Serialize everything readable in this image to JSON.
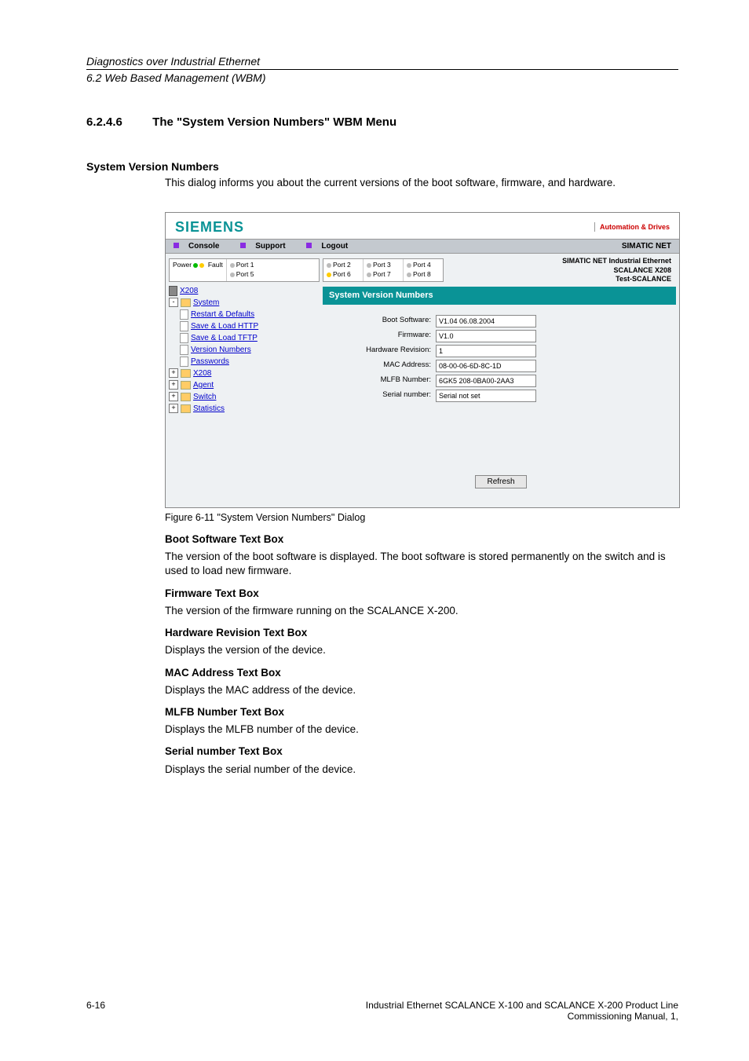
{
  "header": {
    "title": "Diagnostics over Industrial Ethernet",
    "subtitle": "6.2 Web Based Management (WBM)"
  },
  "section": {
    "number": "6.2.4.6",
    "title": "The \"System Version Numbers\" WBM Menu"
  },
  "sysver": {
    "heading": "System Version Numbers",
    "intro": "This dialog informs you about the current versions of the boot software, firmware, and hardware."
  },
  "screenshot": {
    "brand": "SIEMENS",
    "tagline": "Automation & Drives",
    "topbar": {
      "console": "Console",
      "support": "Support",
      "logout": "Logout",
      "right": "SIMATIC NET"
    },
    "ports": {
      "powerfault": "Power",
      "fault": "Fault",
      "p1": "Port 1",
      "p2": "Port 2",
      "p3": "Port 3",
      "p4": "Port 4",
      "p5": "Port 5",
      "p6": "Port 6",
      "p7": "Port 7",
      "p8": "Port 8"
    },
    "rightlabel": {
      "l1": "SIMATIC NET Industrial Ethernet",
      "l2": "SCALANCE X208",
      "l3": "Test-SCALANCE"
    },
    "panel_title": "System Version Numbers",
    "tree": {
      "root": "X208",
      "system": "System",
      "restart": "Restart & Defaults",
      "http": "Save & Load HTTP",
      "tftp": "Save & Load TFTP",
      "ver": "Version Numbers",
      "pwd": "Passwords",
      "x208": "X208",
      "agent": "Agent",
      "switch": "Switch",
      "stats": "Statistics"
    },
    "form": {
      "boot_lbl": "Boot Software:",
      "boot_val": "V1.04 06.08.2004",
      "fw_lbl": "Firmware:",
      "fw_val": "V1.0",
      "hw_lbl": "Hardware Revision:",
      "hw_val": "1",
      "mac_lbl": "MAC Address:",
      "mac_val": "08-00-06-6D-8C-1D",
      "mlfb_lbl": "MLFB Number:",
      "mlfb_val": "6GK5 208-0BA00-2AA3",
      "serial_lbl": "Serial number:",
      "serial_val": "Serial not set",
      "refresh": "Refresh"
    }
  },
  "fig": {
    "caption": "Figure 6-11    \"System Version Numbers\" Dialog"
  },
  "desc": {
    "boot_h": "Boot Software Text Box",
    "boot_p": "The version of the boot software is displayed. The boot software is stored permanently on the switch and is used to load new firmware.",
    "fw_h": "Firmware Text Box",
    "fw_p": "The version of the firmware running on the SCALANCE X-200.",
    "hw_h": "Hardware Revision Text Box",
    "hw_p": "Displays the version of the device.",
    "mac_h": "MAC Address Text Box",
    "mac_p": "Displays the MAC address of the device.",
    "mlfb_h": "MLFB Number Text Box",
    "mlfb_p": "Displays the MLFB number of the device.",
    "serial_h": "Serial number Text Box",
    "serial_p": "Displays the serial number of the device."
  },
  "footer": {
    "page": "6-16",
    "line1": "Industrial Ethernet SCALANCE X-100 and SCALANCE X-200 Product Line",
    "line2": "Commissioning Manual, 1,"
  }
}
